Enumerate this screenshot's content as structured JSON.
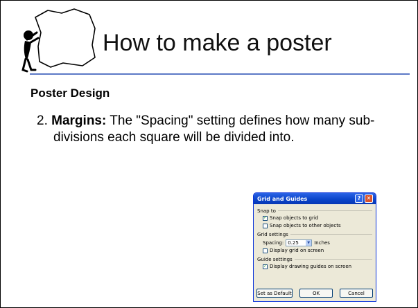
{
  "slide": {
    "title": "How to make a poster",
    "section_heading": "Poster Design",
    "item_number": "2.",
    "item_term": "Margins:",
    "item_text": "The \"Spacing\" setting defines how many sub-divisions each square will be divided into.",
    "rule_color": "#5b78c6"
  },
  "dialog": {
    "title": "Grid and Guides",
    "help_glyph": "?",
    "close_glyph": "✕",
    "snap_group": "Snap to",
    "snap_grid": "Snap objects to grid",
    "snap_grid_checked": true,
    "snap_objects": "Snap objects to other objects",
    "snap_objects_checked": false,
    "grid_group": "Grid settings",
    "spacing_label": "Spacing:",
    "spacing_value": "0.25",
    "spacing_unit": "Inches",
    "display_grid": "Display grid on screen",
    "display_grid_checked": false,
    "guide_group": "Guide settings",
    "display_guides": "Display drawing guides on screen",
    "display_guides_checked": true,
    "set_default_button": "Set as Default",
    "ok_button": "OK",
    "cancel_button": "Cancel",
    "titlebar_color": "#0a43c8"
  },
  "icons": {
    "figure": "person-holding-sign-icon"
  }
}
